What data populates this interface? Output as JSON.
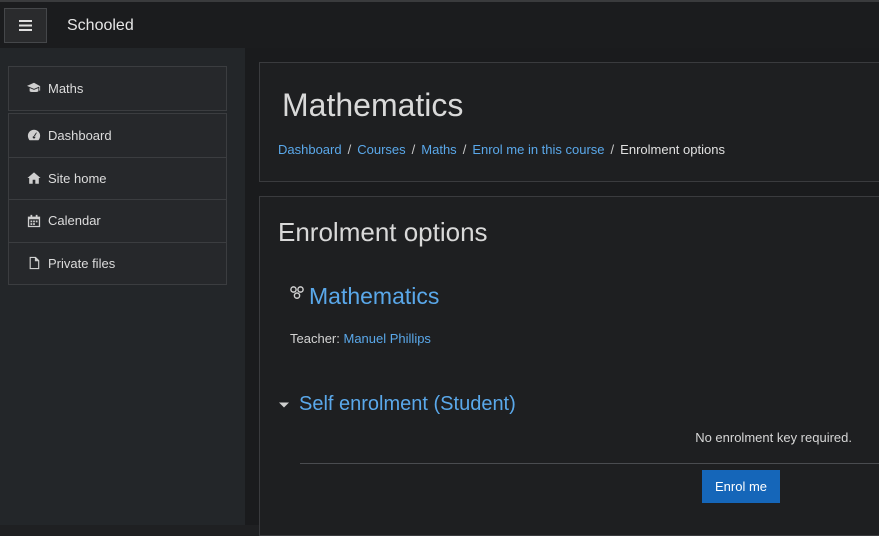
{
  "header": {
    "brand": "Schooled",
    "menu_icon": "hamburger-icon"
  },
  "drawer": {
    "course": {
      "label": "Maths",
      "icon": "graduation-cap-icon"
    },
    "items": [
      {
        "label": "Dashboard",
        "icon": "tachometer-icon"
      },
      {
        "label": "Site home",
        "icon": "home-icon"
      },
      {
        "label": "Calendar",
        "icon": "calendar-icon"
      },
      {
        "label": "Private files",
        "icon": "file-icon"
      }
    ]
  },
  "page": {
    "title": "Mathematics",
    "breadcrumb": [
      "Dashboard",
      "Courses",
      "Maths",
      "Enrol me in this course",
      "Enrolment options"
    ]
  },
  "enrolment": {
    "heading": "Enrolment options",
    "course_name": "Mathematics",
    "teacher_label": "Teacher:",
    "teacher_name": "Manuel Phillips",
    "method_title": "Self enrolment (Student)",
    "no_key_text": "No enrolment key required.",
    "enrol_button": "Enrol me"
  },
  "colors": {
    "link": "#5aa8ea",
    "primary_button": "#1566b9",
    "background": "#1a1b1d"
  }
}
